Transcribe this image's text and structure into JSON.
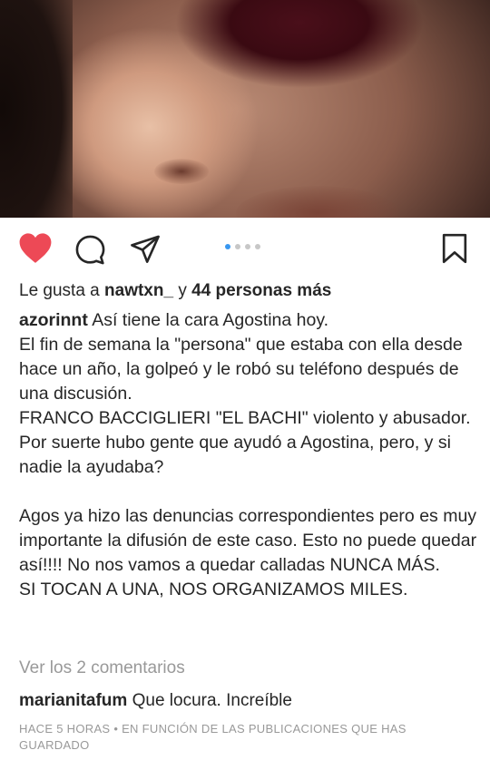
{
  "post": {
    "photo_alt": "",
    "carousel": {
      "count": 4,
      "active_index": 0
    }
  },
  "likes": {
    "prefix": "Le gusta a",
    "user": "nawtxn_",
    "conjunction": "y",
    "others": "44 personas más"
  },
  "caption": {
    "username": "azorinnt",
    "lines": [
      "Así tiene la cara Agostina hoy.",
      "El fin de semana la \"persona\" que estaba con ella desde hace un año, la golpeó y le robó su teléfono después de una discusión.",
      "FRANCO BACCIGLIERI \"EL BACHI\" violento y abusador.",
      "Por suerte hubo gente que ayudó a Agostina, pero, y si nadie la ayudaba?",
      "",
      "Agos ya hizo las denuncias correspondientes pero es muy importante la difusión de este caso. Esto no puede quedar así!!!! No nos vamos a quedar calladas NUNCA MÁS.",
      "SI TOCAN A UNA, NOS ORGANIZAMOS MILES."
    ]
  },
  "comments": {
    "view_all_label": "Ver los 2 comentarios",
    "items": [
      {
        "username": "marianitafum",
        "text": "Que locura. Increíble"
      }
    ]
  },
  "meta_text": "HACE 5 HORAS • EN FUNCIÓN DE LAS PUBLICACIONES QUE HAS GUARDADO",
  "colors": {
    "like_red": "#ed4956",
    "accent_blue": "#3897f0",
    "text": "#262626",
    "muted": "#999999"
  },
  "icons": [
    "heart-icon",
    "comment-icon",
    "share-icon",
    "bookmark-icon"
  ]
}
